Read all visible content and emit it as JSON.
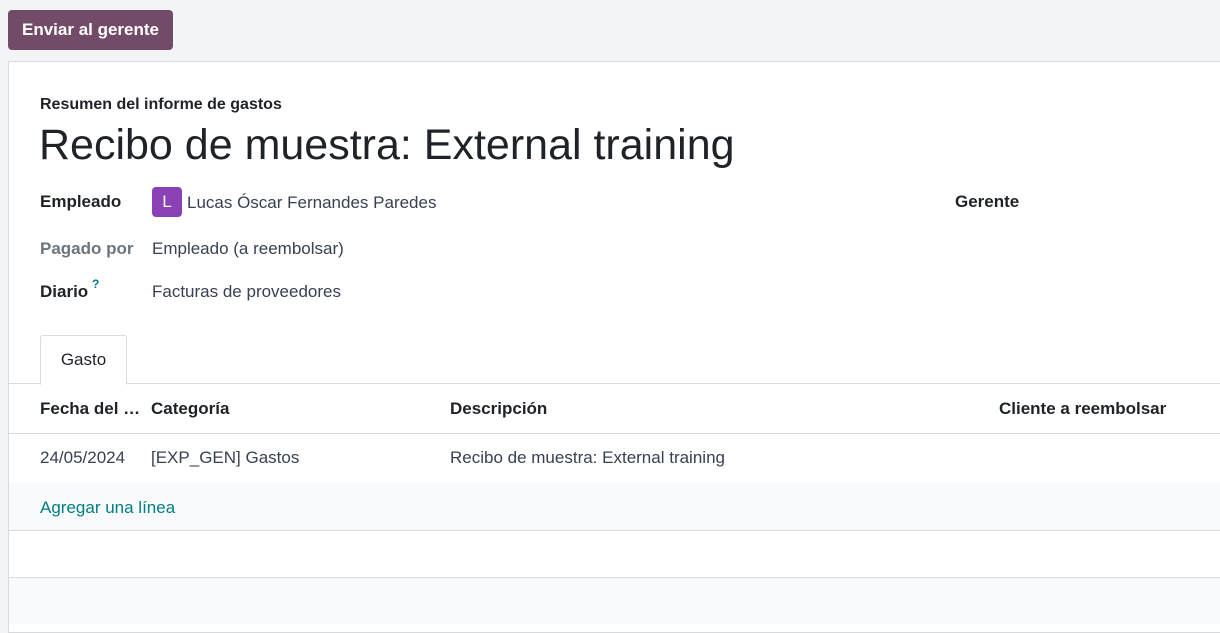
{
  "toolbar": {
    "send_button": "Enviar al gerente"
  },
  "form": {
    "subtitle": "Resumen del informe de gastos",
    "title": "Recibo de muestra: External training",
    "employee_label": "Empleado",
    "employee_initial": "L",
    "employee_name": "Lucas Óscar Fernandes Paredes",
    "manager_label": "Gerente",
    "paid_by_label": "Pagado por",
    "paid_by_value": "Empleado (a reembolsar)",
    "journal_label": "Diario",
    "journal_help": "?",
    "journal_value": "Facturas de proveedores"
  },
  "tabs": [
    {
      "label": "Gasto",
      "active": true
    }
  ],
  "table": {
    "columns": [
      "Fecha del …",
      "Categoría",
      "Descripción",
      "Cliente a reembolsar"
    ],
    "rows": [
      [
        "24/05/2024",
        "[EXP_GEN] Gastos",
        "Recibo de muestra: External training",
        ""
      ]
    ],
    "add_line": "Agregar una línea"
  },
  "colors": {
    "primary": "#714b67",
    "avatar": "#8a41b6",
    "link": "#017e84"
  }
}
